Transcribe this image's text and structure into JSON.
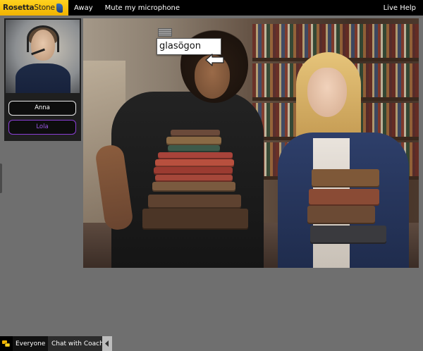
{
  "app": {
    "logo_bold": "Rosetta",
    "logo_light": "Stone"
  },
  "topbar": {
    "away_label": "Away",
    "mute_label": "Mute my microphone",
    "help_label": "Live Help"
  },
  "participants": [
    {
      "name": "Anna",
      "color": "#ffffff"
    },
    {
      "name": "Lola",
      "color": "#9b59e6"
    }
  ],
  "lesson": {
    "vocab_word": "glasögon"
  },
  "chat": {
    "tabs": [
      {
        "label": "Everyone",
        "active": false
      },
      {
        "label": "Chat with Coach",
        "active": true
      }
    ]
  },
  "icons": {
    "chat": "chat-bubbles-icon",
    "collapse": "chevron-left-icon",
    "drag": "drag-handle-icon",
    "pointer": "arrow-left-icon"
  },
  "colors": {
    "brand_yellow": "#ffd21f",
    "topbar": "#000000",
    "background": "#6f6f6f",
    "active_user_outline": "#8b3fd6"
  }
}
